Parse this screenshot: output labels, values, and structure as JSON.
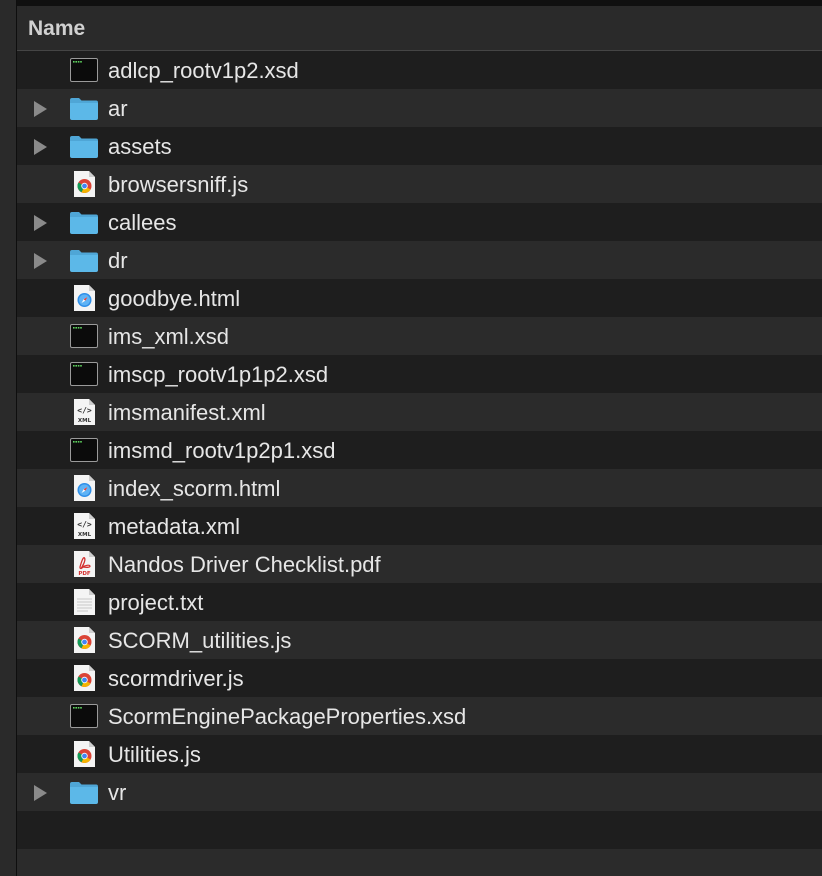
{
  "header": {
    "name_label": "Name"
  },
  "files": [
    {
      "name": "adlcp_rootv1p2.xsd",
      "kind": "xsd",
      "icon": "terminal-document-icon",
      "expandable": false
    },
    {
      "name": "ar",
      "kind": "folder",
      "icon": "folder-icon",
      "expandable": true
    },
    {
      "name": "assets",
      "kind": "folder",
      "icon": "folder-icon",
      "expandable": true
    },
    {
      "name": "browsersniff.js",
      "kind": "js",
      "icon": "chrome-document-icon",
      "expandable": false
    },
    {
      "name": "callees",
      "kind": "folder",
      "icon": "folder-icon",
      "expandable": true
    },
    {
      "name": "dr",
      "kind": "folder",
      "icon": "folder-icon",
      "expandable": true
    },
    {
      "name": "goodbye.html",
      "kind": "html",
      "icon": "safari-document-icon",
      "expandable": false
    },
    {
      "name": "ims_xml.xsd",
      "kind": "xsd",
      "icon": "terminal-document-icon",
      "expandable": false
    },
    {
      "name": "imscp_rootv1p1p2.xsd",
      "kind": "xsd",
      "icon": "terminal-document-icon",
      "expandable": false
    },
    {
      "name": "imsmanifest.xml",
      "kind": "xml",
      "icon": "xml-document-icon",
      "expandable": false
    },
    {
      "name": "imsmd_rootv1p2p1.xsd",
      "kind": "xsd",
      "icon": "terminal-document-icon",
      "expandable": false
    },
    {
      "name": "index_scorm.html",
      "kind": "html",
      "icon": "safari-document-icon",
      "expandable": false
    },
    {
      "name": "metadata.xml",
      "kind": "xml",
      "icon": "xml-document-icon",
      "expandable": false
    },
    {
      "name": "Nandos Driver Checklist.pdf",
      "kind": "pdf",
      "icon": "pdf-document-icon",
      "expandable": false
    },
    {
      "name": "project.txt",
      "kind": "txt",
      "icon": "text-document-icon",
      "expandable": false
    },
    {
      "name": "SCORM_utilities.js",
      "kind": "js",
      "icon": "chrome-document-icon",
      "expandable": false
    },
    {
      "name": "scormdriver.js",
      "kind": "js",
      "icon": "chrome-document-icon",
      "expandable": false
    },
    {
      "name": "ScormEnginePackageProperties.xsd",
      "kind": "xsd",
      "icon": "terminal-document-icon",
      "expandable": false
    },
    {
      "name": "Utilities.js",
      "kind": "js",
      "icon": "chrome-document-icon",
      "expandable": false
    },
    {
      "name": "vr",
      "kind": "folder",
      "icon": "folder-icon",
      "expandable": true
    }
  ],
  "xml_badge": "XML",
  "pdf_badge": "PDF",
  "colors": {
    "folder": "#5cb8e8",
    "text": "#e6e6e6",
    "row_alt": "#2b2b2b",
    "background": "#1e1e1e"
  }
}
